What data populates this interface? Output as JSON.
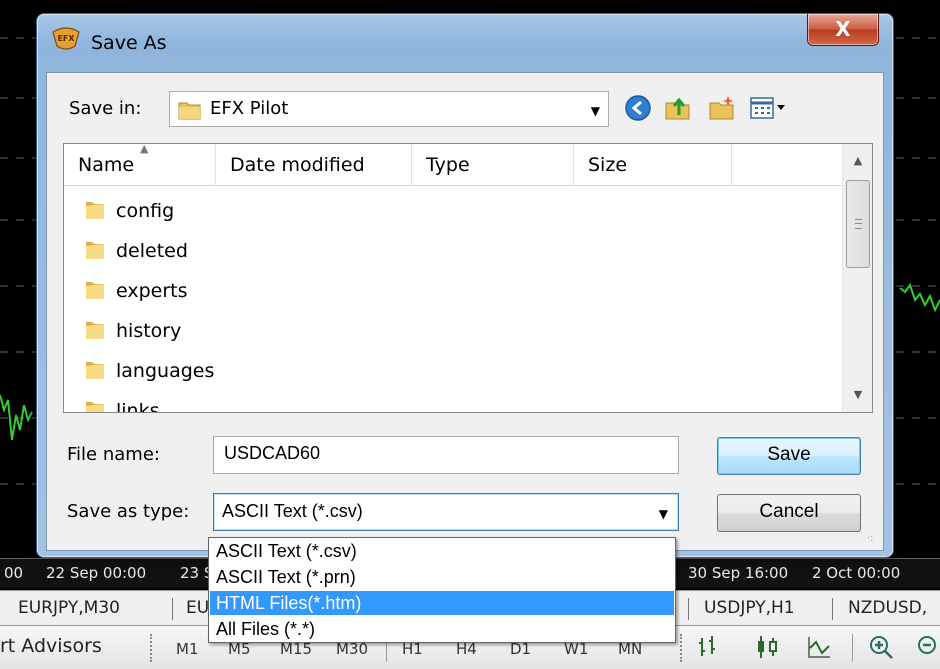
{
  "dialog": {
    "title": "Save As",
    "close_glyph": "X",
    "save_in_label": "Save in:",
    "save_in_value": "EFX Pilot",
    "nav_icons": [
      "back-icon",
      "up-folder-icon",
      "new-folder-icon",
      "view-menu-icon"
    ],
    "columns": [
      "Name",
      "Date modified",
      "Type",
      "Size"
    ],
    "folders": [
      "config",
      "deleted",
      "experts",
      "history",
      "languages",
      "links"
    ],
    "file_name_label": "File name:",
    "file_name_value": "USDCAD60",
    "save_as_type_label": "Save as type:",
    "save_as_type_value": "ASCII Text (*.csv)",
    "save_button": "Save",
    "cancel_button": "Cancel"
  },
  "dropdown": {
    "options": [
      "ASCII Text (*.csv)",
      "ASCII Text (*.prn)",
      "HTML Files(*.htm)",
      "All Files (*.*)"
    ],
    "selected_index": 2
  },
  "background": {
    "time_axis": [
      "00",
      "22 Sep 00:00",
      "23 S",
      "30 Sep 16:00",
      "2 Oct 00:00"
    ],
    "symbol_tabs": [
      "EURJPY,M30",
      "EU",
      "USDJPY,H1",
      "NZDUSD,"
    ],
    "toolbar_label": "rt Advisors",
    "timeframes": [
      "M1",
      "M5",
      "M15",
      "M30",
      "H1",
      "H4",
      "D1",
      "W1",
      "MN"
    ]
  },
  "colors": {
    "chart_background": "#000000",
    "chart_grid": "#5a6a6a",
    "chart_line": "#33cc33",
    "selection": "#3399ff",
    "dialog_frame": "#a3c3e3",
    "close_button": "#c95a40"
  }
}
